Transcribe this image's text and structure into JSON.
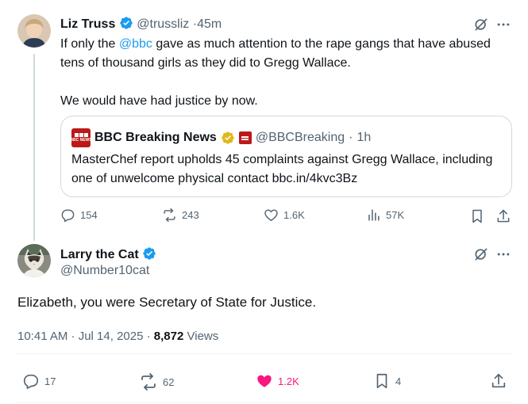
{
  "tweet1": {
    "author": "Liz Truss",
    "handle": "@trussliz",
    "time": "45m",
    "text_part1": "If only the ",
    "mention": "@bbc",
    "text_part2": " gave as much attention to the rape gangs that have abused tens of thousand girls as they did to Gregg Wallace.",
    "text_para2": "We would have had justice by now.",
    "quote": {
      "logo_text": "BBC NEWS",
      "author": "BBC Breaking News",
      "handle": "@BBCBreaking",
      "time": "1h",
      "text": "MasterChef report upholds 45 complaints against Gregg Wallace, including one of unwelcome physical contact bbc.in/4kvc3Bz"
    },
    "actions": {
      "replies": "154",
      "reposts": "243",
      "likes": "1.6K",
      "views": "57K"
    }
  },
  "tweet2": {
    "author": "Larry the Cat",
    "handle": "@Number10cat",
    "text": "Elizabeth, you were Secretary of State for Justice.",
    "timestamp": "10:41 AM · Jul 14, 2025",
    "views_count": "8,872",
    "views_label": "Views",
    "actions": {
      "replies": "17",
      "reposts": "62",
      "likes": "1.2K",
      "bookmarks": "4"
    }
  },
  "colors": {
    "accent": "#1d9bf0",
    "muted": "#536471",
    "like": "#f91880",
    "gold_badge": "#e2b719",
    "bbc_red": "#bb1919"
  }
}
